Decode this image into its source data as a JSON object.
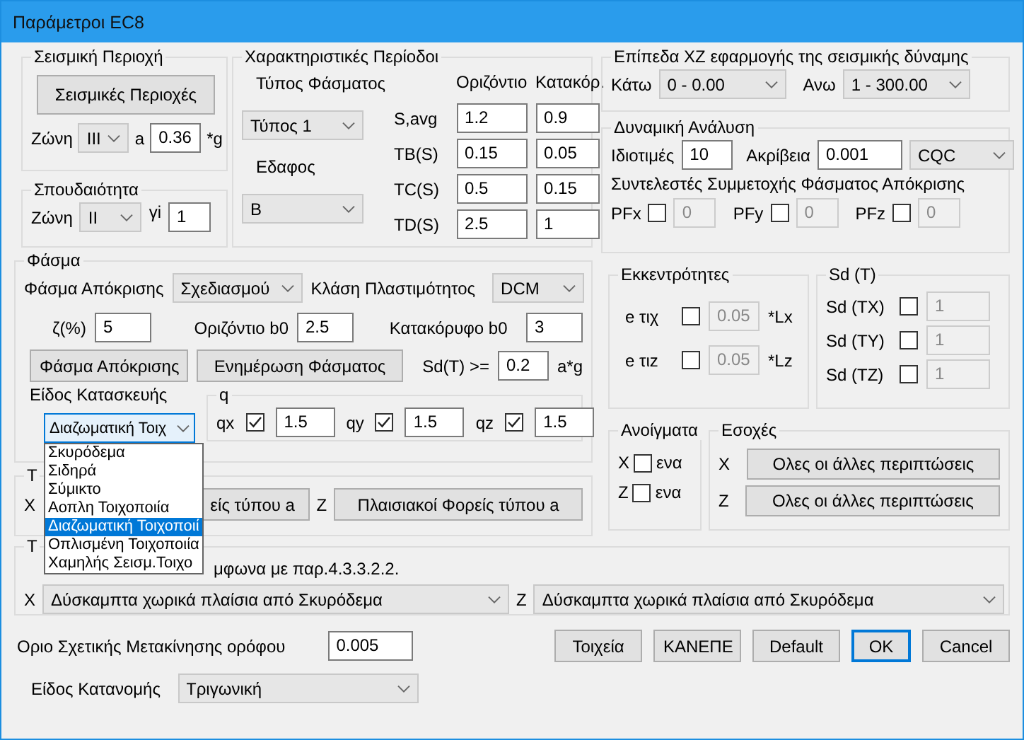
{
  "window": {
    "title": "Παράμετροι EC8"
  },
  "seismic_region": {
    "title": "Σεισμική Περιοχή",
    "button": "Σεισμικές Περιοχές",
    "zone_label": "Ζώνη",
    "zone": "III",
    "a_label": "a",
    "a_value": "0.36",
    "a_unit": "*g"
  },
  "importance": {
    "title": "Σπουδαιότητα",
    "zone_label": "Ζώνη",
    "zone": "II",
    "gi_label": "γi",
    "gi_value": "1"
  },
  "periods": {
    "title": "Χαρακτηριστικές Περίοδοι",
    "spectrum_type_label": "Τύπος Φάσματος",
    "spectrum_type": "Τύπος 1",
    "soil_label": "Εδαφος",
    "soil": "B",
    "columns": [
      "Οριζόντιο",
      "Κατακόρ."
    ],
    "rows": [
      {
        "label": "S,avg",
        "horizontal": "1.2",
        "vertical": "0.9"
      },
      {
        "label": "TB(S)",
        "horizontal": "0.15",
        "vertical": "0.05"
      },
      {
        "label": "TC(S)",
        "horizontal": "0.5",
        "vertical": "0.15"
      },
      {
        "label": "TD(S)",
        "horizontal": "2.5",
        "vertical": "1"
      }
    ]
  },
  "levels": {
    "title": "Επίπεδα XZ εφαρμογής της σεισμικής δύναμης",
    "lower_label": "Κάτω",
    "lower": "0 - 0.00",
    "upper_label": "Ανω",
    "upper": "1 - 300.00"
  },
  "dynamic": {
    "title": "Δυναμική Ανάλυση",
    "modes_label": "Ιδιοτιμές",
    "modes": "10",
    "accuracy_label": "Ακρίβεια",
    "accuracy": "0.001",
    "method": "CQC",
    "factors_title": "Συντελεστές Συμμετοχής Φάσματος Απόκρισης",
    "factors": [
      {
        "label": "PFx",
        "checked": false,
        "value": "0"
      },
      {
        "label": "PFy",
        "checked": false,
        "value": "0"
      },
      {
        "label": "PFz",
        "checked": false,
        "value": "0"
      }
    ]
  },
  "spectrum": {
    "title": "Φάσμα",
    "response_label": "Φάσμα Απόκρισης",
    "response": "Σχεδιασμού",
    "ductility_label": "Κλάση Πλαστιμότητος",
    "ductility": "DCM",
    "damping_label": "ζ(%)",
    "damping": "5",
    "b0h_label": "Οριζόντιο b0",
    "b0h": "2.5",
    "b0v_label": "Κατακόρυφο b0",
    "b0v": "3",
    "buttons": [
      "Φάσμα Απόκρισης",
      "Ενημέρωση Φάσματος"
    ],
    "sd_label": "Sd(T) >=",
    "sd": "0.2",
    "sd_unit": "a*g",
    "structure_label": "Είδος Κατασκευής",
    "structure": "Διαζωματική Τοιχ",
    "structure_options": [
      {
        "label": "Σκυρόδεμα",
        "selected": false
      },
      {
        "label": "Σιδηρά",
        "selected": false
      },
      {
        "label": "Σύμικτο",
        "selected": false
      },
      {
        "label": "Αοπλη Τοιχοποιία",
        "selected": false
      },
      {
        "label": "Διαζωματική Τοιχοποιί",
        "selected": true
      },
      {
        "label": "Οπλισμένη Τοιχοποιία",
        "selected": false
      },
      {
        "label": "Χαμηλής Σεισμ.Τοιχο",
        "selected": false
      }
    ],
    "q": {
      "title": "q",
      "items": [
        {
          "label": "qx",
          "checked": true,
          "value": "1.5"
        },
        {
          "label": "qy",
          "checked": true,
          "value": "1.5"
        },
        {
          "label": "qz",
          "checked": true,
          "value": "1.5"
        }
      ]
    }
  },
  "frames": {
    "title": "Τ",
    "x_label": "X",
    "x_button": "είς τύπου a",
    "z_label": "Z",
    "z_button": "Πλαισιακοί Φορείς τύπου a"
  },
  "eccentricity": {
    "title": "Εκκεντρότητες",
    "items": [
      {
        "label": "e τιχ",
        "checked": false,
        "value": "0.05",
        "unit": "*Lx"
      },
      {
        "label": "e τιz",
        "checked": false,
        "value": "0.05",
        "unit": "*Lz"
      }
    ]
  },
  "sd_t": {
    "title": "Sd (T)",
    "items": [
      {
        "label": "Sd (TX)",
        "checked": false,
        "value": "1"
      },
      {
        "label": "Sd (TY)",
        "checked": false,
        "value": "1"
      },
      {
        "label": "Sd (TZ)",
        "checked": false,
        "value": "1"
      }
    ]
  },
  "openings": {
    "title": "Ανοίγματα",
    "items": [
      {
        "axis": "X",
        "label": "ενα",
        "checked": false
      },
      {
        "axis": "Z",
        "label": "ενα",
        "checked": false
      }
    ]
  },
  "recesses": {
    "title": "Εσοχές",
    "items": [
      {
        "axis": "X",
        "button": "Ολες οι άλλες περιπτώσεις"
      },
      {
        "axis": "Z",
        "button": "Ολες οι άλλες περιπτώσεις"
      }
    ]
  },
  "system": {
    "title": "Τ",
    "note": "μφωνα με παρ.4.3.3.2.2.",
    "x_label": "X",
    "x": "Δύσκαμπτα χωρικά πλαίσια από Σκυρόδεμα",
    "z_label": "Z",
    "z": "Δύσκαμπτα χωρικά πλαίσια από Σκυρόδεμα"
  },
  "drift": {
    "label": "Οριο Σχετικής Μετακίνησης ορόφου",
    "value": "0.005"
  },
  "distribution": {
    "label": "Είδος Κατανομής",
    "value": "Τριγωνική"
  },
  "buttons": [
    {
      "label": "Τοιχεία",
      "default": false
    },
    {
      "label": "ΚΑΝΕΠΕ",
      "default": false
    },
    {
      "label": "Default",
      "default": false
    },
    {
      "label": "OK",
      "default": true
    },
    {
      "label": "Cancel",
      "default": false
    }
  ]
}
